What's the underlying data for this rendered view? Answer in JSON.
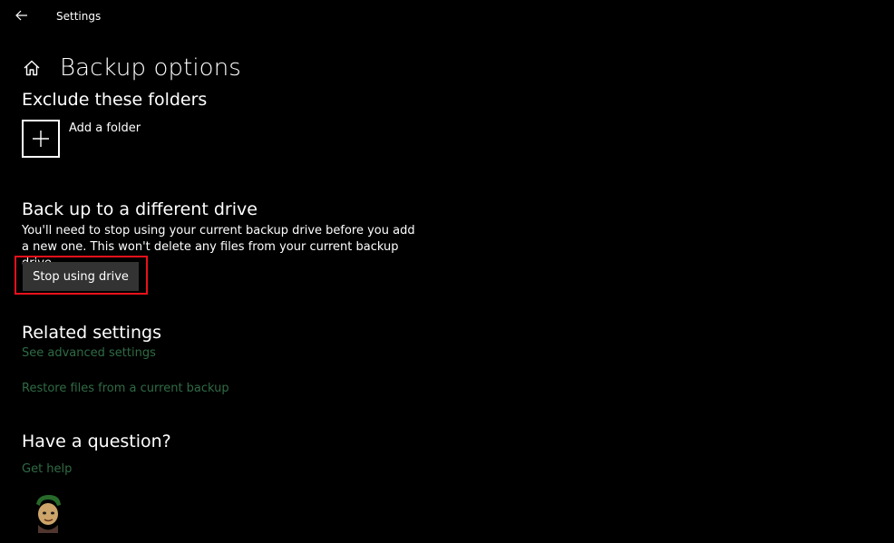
{
  "window": {
    "app_title": "Settings"
  },
  "header": {
    "title": "Backup options"
  },
  "exclude": {
    "heading": "Exclude these folders",
    "add_folder_label": "Add a folder"
  },
  "different_drive": {
    "heading": "Back up to a different drive",
    "description": "You'll need to stop using your current backup drive before you add a new one. This won't delete any files from your current backup drive.",
    "button_label": "Stop using drive"
  },
  "related": {
    "heading": "Related settings",
    "links": [
      "See advanced settings",
      "Restore files from a current backup"
    ]
  },
  "question": {
    "heading": "Have a question?",
    "link": "Get help"
  },
  "colors": {
    "background": "#000000",
    "text": "#ffffff",
    "button": "#333333",
    "link": "#2f6b44",
    "highlight": "#e8111b"
  },
  "icons": [
    "back-arrow-icon",
    "home-icon",
    "plus-icon"
  ]
}
